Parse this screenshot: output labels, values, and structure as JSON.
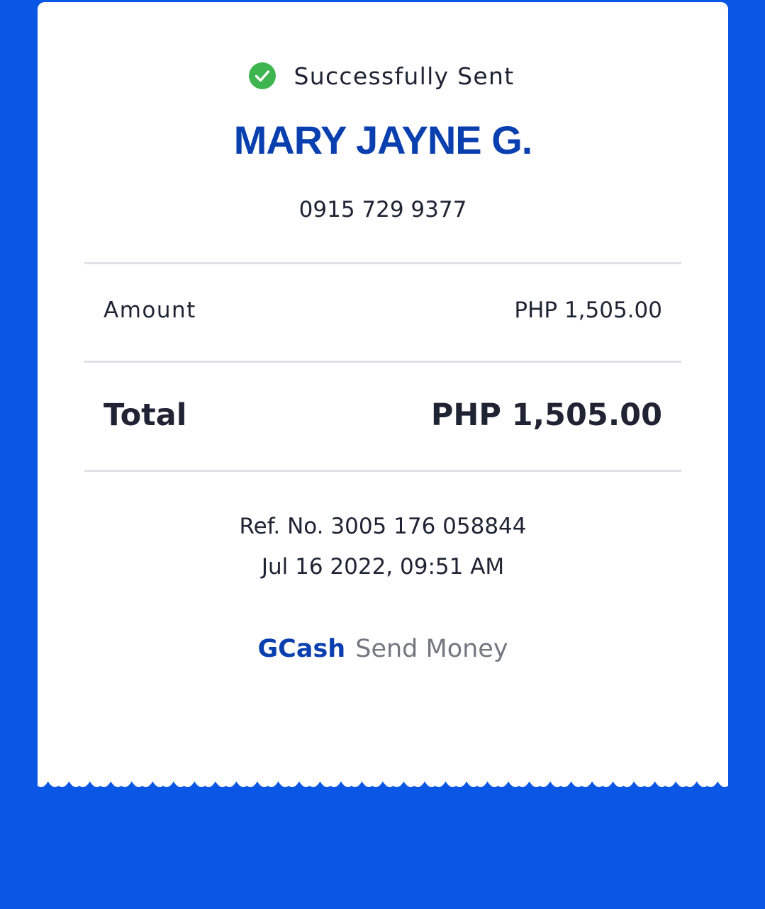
{
  "colors": {
    "background": "#0a57e6",
    "card": "#ffffff",
    "accent": "#0a3faf",
    "success": "#3fb54f",
    "divider": "#dfe1e6"
  },
  "status": {
    "icon": "check-circle-icon",
    "text": "Successfully Sent"
  },
  "recipient": {
    "name": "MARY JAYNE G.",
    "number": "0915 729 9377"
  },
  "amount": {
    "label": "Amount",
    "value": "PHP 1,505.00"
  },
  "total": {
    "label": "Total",
    "value": "PHP 1,505.00"
  },
  "reference": {
    "ref": "Ref. No. 3005 176 058844",
    "datetime": "Jul 16 2022, 09:51 AM"
  },
  "footer": {
    "brand": "GCash",
    "service": "Send Money"
  }
}
